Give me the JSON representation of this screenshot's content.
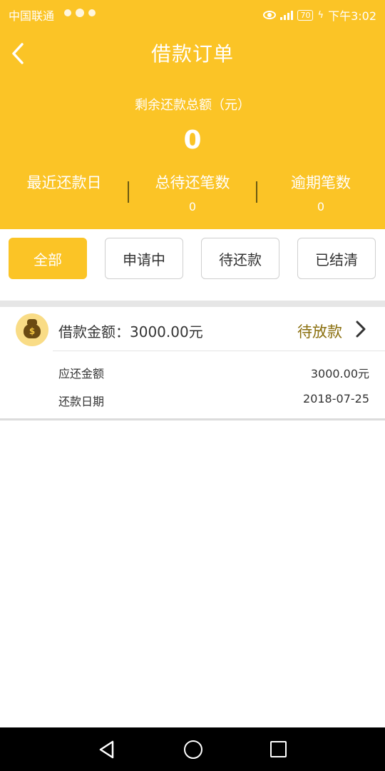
{
  "status_bar": {
    "carrier": "中国联通",
    "battery": "70",
    "time": "下午3:02"
  },
  "header": {
    "title": "借款订单",
    "remaining_label": "剩余还款总额（元）",
    "remaining_value": "0",
    "stats": [
      {
        "label": "最近还款日",
        "value": ""
      },
      {
        "label": "总待还笔数",
        "value": "0"
      },
      {
        "label": "逾期笔数",
        "value": "0"
      }
    ],
    "accent_color": "#fbc426"
  },
  "tabs": [
    {
      "label": "全部",
      "active": true
    },
    {
      "label": "申请中",
      "active": false
    },
    {
      "label": "待还款",
      "active": false
    },
    {
      "label": "已结清",
      "active": false
    }
  ],
  "order": {
    "amount_label": "借款金额：",
    "amount_value": "3000.00元",
    "status": "待放款",
    "rows": [
      {
        "label": "应还金额",
        "value": "3000.00元"
      },
      {
        "label": "还款日期",
        "value": "2018-07-25"
      }
    ],
    "icon": "money-bag-icon"
  }
}
